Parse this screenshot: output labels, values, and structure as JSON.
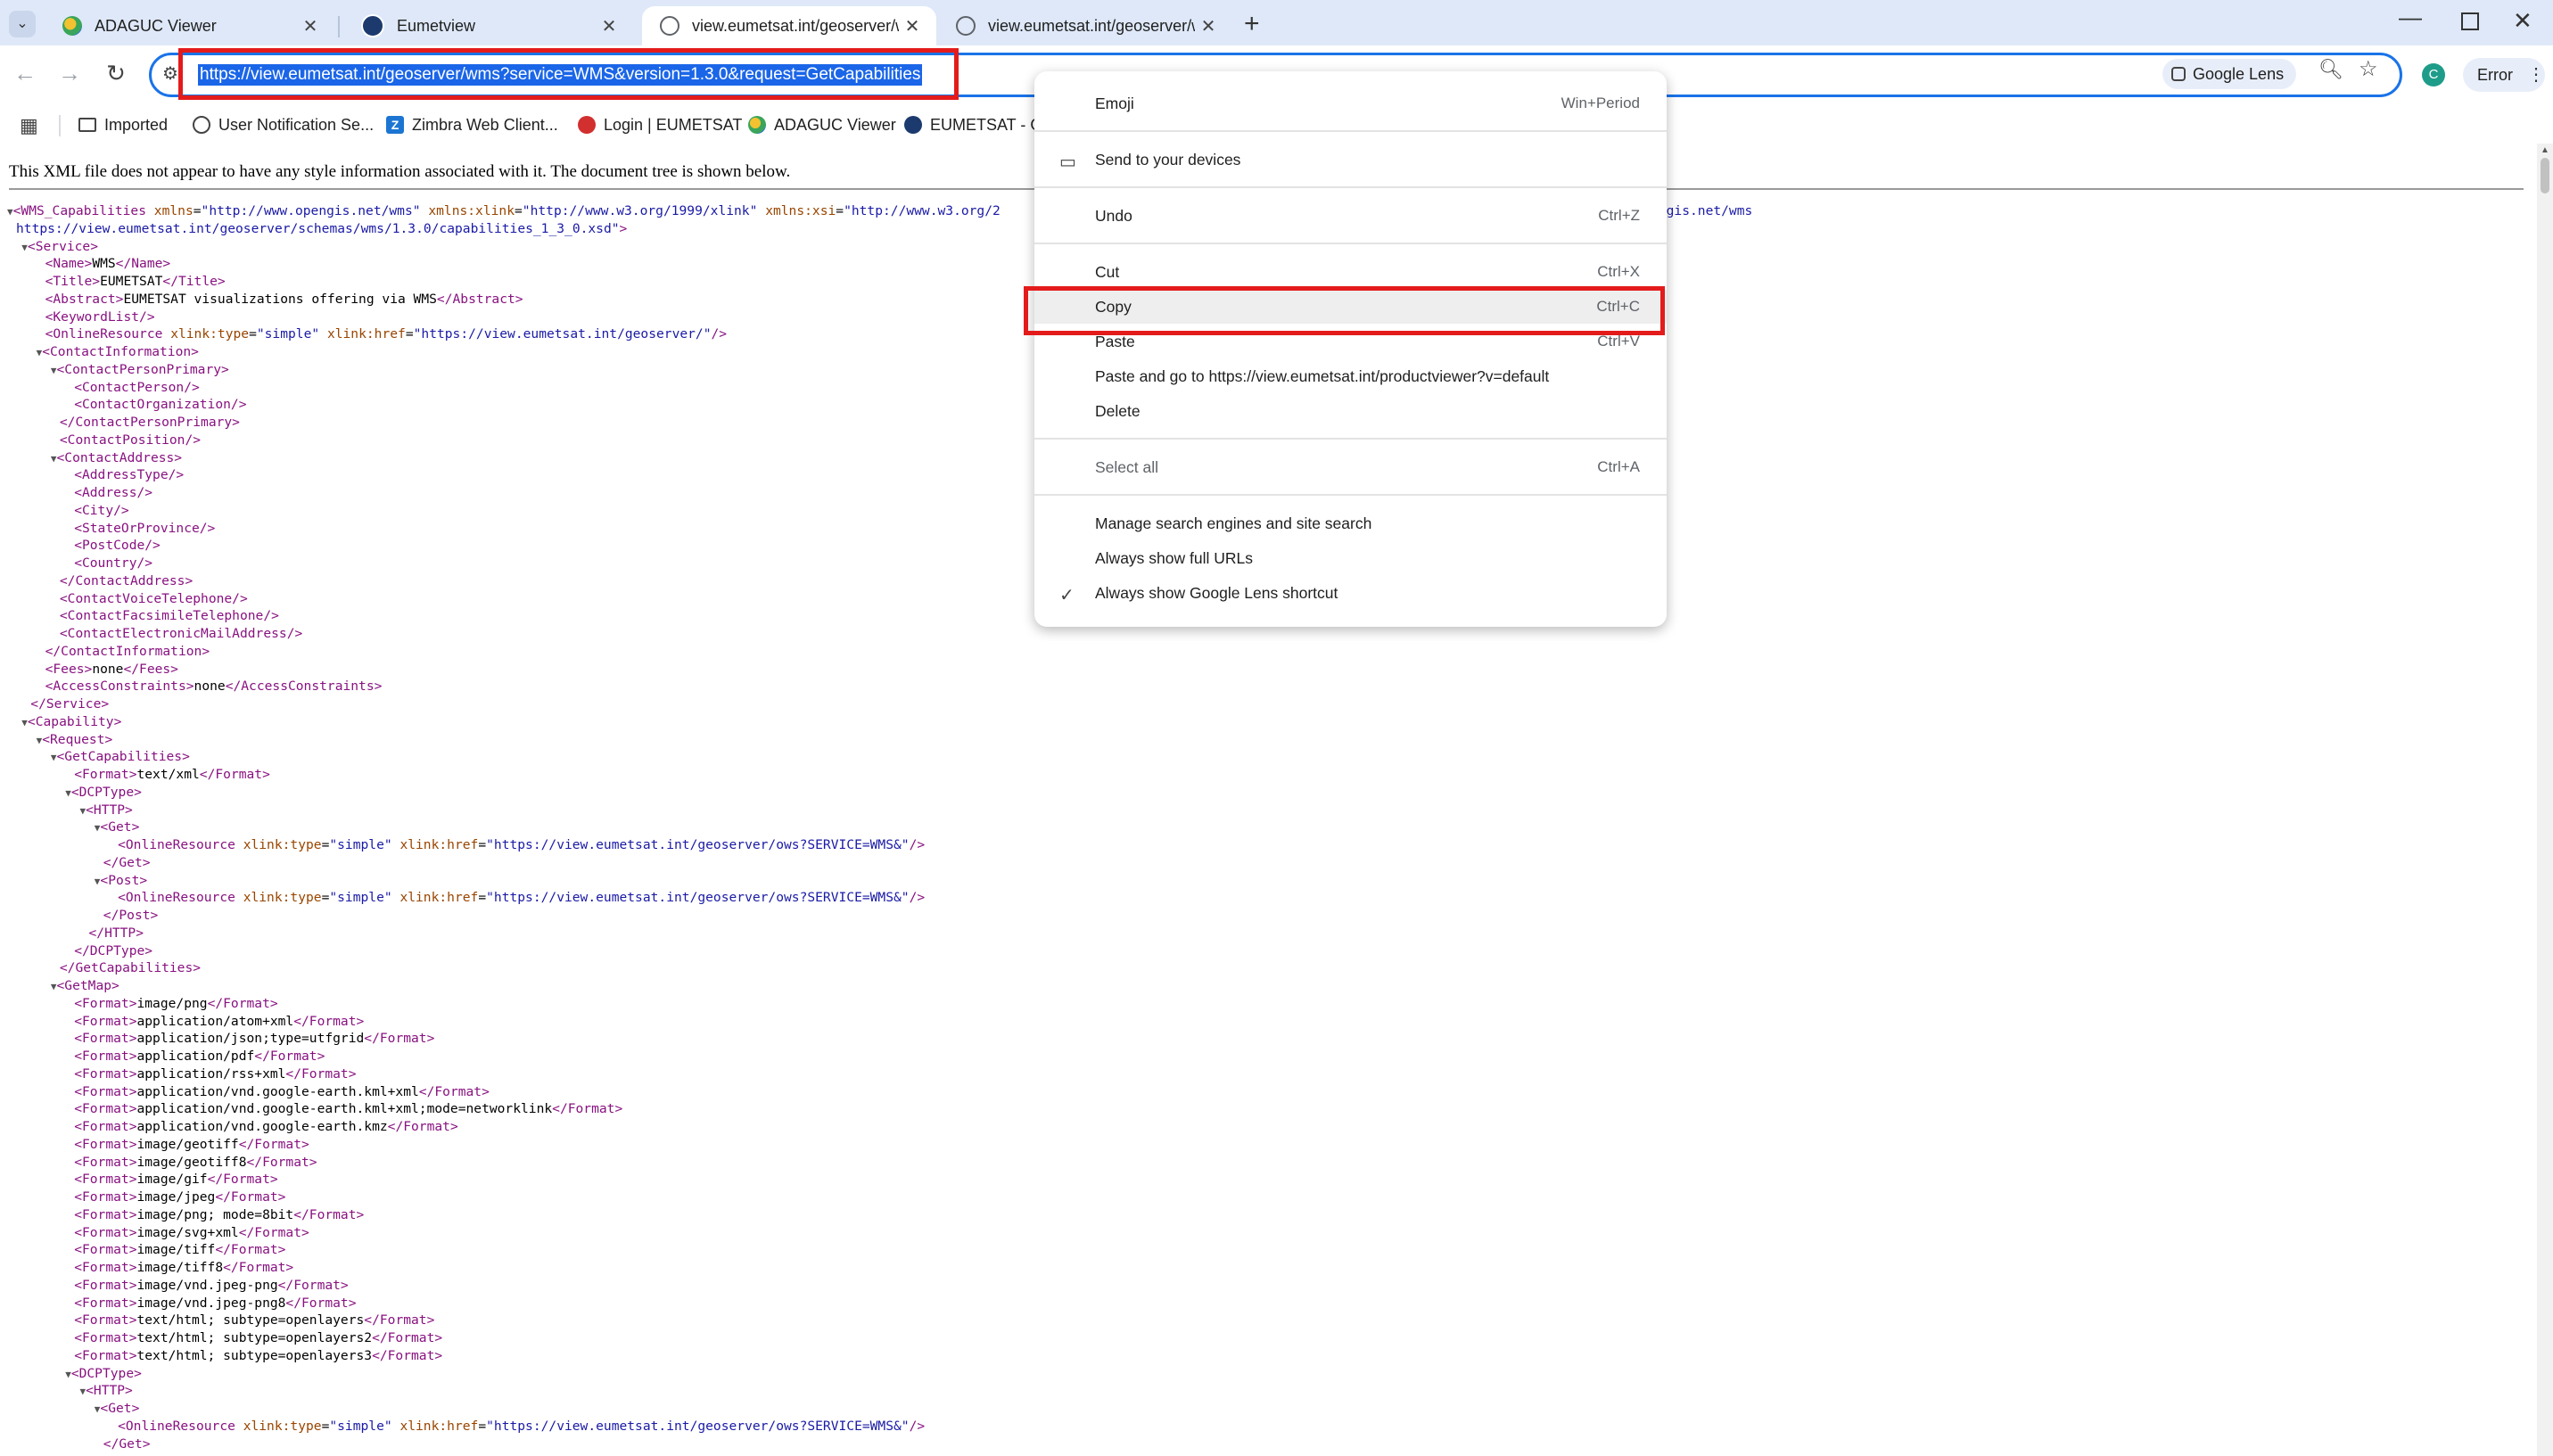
{
  "tabs": [
    {
      "title": "ADAGUC Viewer",
      "active": false
    },
    {
      "title": "Eumetview",
      "active": false
    },
    {
      "title": "view.eumetsat.int/geoserver/wm",
      "active": true
    },
    {
      "title": "view.eumetsat.int/geoserver/wm",
      "active": false
    }
  ],
  "toolbar": {
    "url": "https://view.eumetsat.int/geoserver/wms?service=WMS&version=1.3.0&request=GetCapabilities",
    "lens_label": "Google Lens",
    "profile_initial": "C",
    "error_label": "Error"
  },
  "bookmarks": [
    {
      "label": "Imported"
    },
    {
      "label": "User Notification Se..."
    },
    {
      "label": "Zimbra Web Client..."
    },
    {
      "label": "Login | EUMETSAT"
    },
    {
      "label": "ADAGUC Viewer"
    },
    {
      "label": "EUMETSAT - OS"
    }
  ],
  "page": {
    "notice": "This XML file does not appear to have any style information associated with it. The document tree is shown below."
  },
  "xml_lines": [
    {
      "i": 0,
      "t": "▼",
      "h": "<span class='tg'>&lt;WMS_Capabilities</span> <span class='an'>xmlns</span>=<span class='av'>\"http://www.opengis.net/wms\"</span> <span class='an'>xmlns:xlink</span>=<span class='av'>\"http://www.w3.org/1999/xlink\"</span> <span class='an'>xmlns:xsi</span>=<span class='av'>\"http://www.w3.org/2</span>                                                                  <span class='an'>on</span>=<span class='av'>\"http://www.opengis.net/wms</span>"
    },
    {
      "i": 0,
      "t": "",
      "h": "<span class='av'>https://view.eumetsat.int/geoserver/schemas/wms/1.3.0/capabilities_1_3_0.xsd\"</span><span class='tg'>&gt;</span>"
    },
    {
      "i": 1,
      "t": "▼",
      "h": "<span class='tg'>&lt;Service&gt;</span>"
    },
    {
      "i": 2,
      "t": "",
      "h": "<span class='tg'>&lt;Name&gt;</span>WMS<span class='tg'>&lt;/Name&gt;</span>"
    },
    {
      "i": 2,
      "t": "",
      "h": "<span class='tg'>&lt;Title&gt;</span>EUMETSAT<span class='tg'>&lt;/Title&gt;</span>"
    },
    {
      "i": 2,
      "t": "",
      "h": "<span class='tg'>&lt;Abstract&gt;</span>EUMETSAT visualizations offering via WMS<span class='tg'>&lt;/Abstract&gt;</span>"
    },
    {
      "i": 2,
      "t": "",
      "h": "<span class='tg'>&lt;KeywordList/&gt;</span>"
    },
    {
      "i": 2,
      "t": "",
      "h": "<span class='tg'>&lt;OnlineResource</span> <span class='an'>xlink:type</span>=<span class='av'>\"simple\"</span> <span class='an'>xlink:href</span>=<span class='av'>\"https://view.eumetsat.int/geoserver/\"</span><span class='tg'>/&gt;</span>"
    },
    {
      "i": 2,
      "t": "▼",
      "h": "<span class='tg'>&lt;ContactInformation&gt;</span>"
    },
    {
      "i": 3,
      "t": "▼",
      "h": "<span class='tg'>&lt;ContactPersonPrimary&gt;</span>"
    },
    {
      "i": 4,
      "t": "",
      "h": "<span class='tg'>&lt;ContactPerson/&gt;</span>"
    },
    {
      "i": 4,
      "t": "",
      "h": "<span class='tg'>&lt;ContactOrganization/&gt;</span>"
    },
    {
      "i": 3,
      "t": "",
      "h": "<span class='tg'>&lt;/ContactPersonPrimary&gt;</span>"
    },
    {
      "i": 3,
      "t": "",
      "h": "<span class='tg'>&lt;ContactPosition/&gt;</span>"
    },
    {
      "i": 3,
      "t": "▼",
      "h": "<span class='tg'>&lt;ContactAddress&gt;</span>"
    },
    {
      "i": 4,
      "t": "",
      "h": "<span class='tg'>&lt;AddressType/&gt;</span>"
    },
    {
      "i": 4,
      "t": "",
      "h": "<span class='tg'>&lt;Address/&gt;</span>"
    },
    {
      "i": 4,
      "t": "",
      "h": "<span class='tg'>&lt;City/&gt;</span>"
    },
    {
      "i": 4,
      "t": "",
      "h": "<span class='tg'>&lt;StateOrProvince/&gt;</span>"
    },
    {
      "i": 4,
      "t": "",
      "h": "<span class='tg'>&lt;PostCode/&gt;</span>"
    },
    {
      "i": 4,
      "t": "",
      "h": "<span class='tg'>&lt;Country/&gt;</span>"
    },
    {
      "i": 3,
      "t": "",
      "h": "<span class='tg'>&lt;/ContactAddress&gt;</span>"
    },
    {
      "i": 3,
      "t": "",
      "h": "<span class='tg'>&lt;ContactVoiceTelephone/&gt;</span>"
    },
    {
      "i": 3,
      "t": "",
      "h": "<span class='tg'>&lt;ContactFacsimileTelephone/&gt;</span>"
    },
    {
      "i": 3,
      "t": "",
      "h": "<span class='tg'>&lt;ContactElectronicMailAddress/&gt;</span>"
    },
    {
      "i": 2,
      "t": "",
      "h": "<span class='tg'>&lt;/ContactInformation&gt;</span>"
    },
    {
      "i": 2,
      "t": "",
      "h": "<span class='tg'>&lt;Fees&gt;</span>none<span class='tg'>&lt;/Fees&gt;</span>"
    },
    {
      "i": 2,
      "t": "",
      "h": "<span class='tg'>&lt;AccessConstraints&gt;</span>none<span class='tg'>&lt;/AccessConstraints&gt;</span>"
    },
    {
      "i": 1,
      "t": "",
      "h": "<span class='tg'>&lt;/Service&gt;</span>"
    },
    {
      "i": 1,
      "t": "▼",
      "h": "<span class='tg'>&lt;Capability&gt;</span>"
    },
    {
      "i": 2,
      "t": "▼",
      "h": "<span class='tg'>&lt;Request&gt;</span>"
    },
    {
      "i": 3,
      "t": "▼",
      "h": "<span class='tg'>&lt;GetCapabilities&gt;</span>"
    },
    {
      "i": 4,
      "t": "",
      "h": "<span class='tg'>&lt;Format&gt;</span>text/xml<span class='tg'>&lt;/Format&gt;</span>"
    },
    {
      "i": 4,
      "t": "▼",
      "h": "<span class='tg'>&lt;DCPType&gt;</span>"
    },
    {
      "i": 5,
      "t": "▼",
      "h": "<span class='tg'>&lt;HTTP&gt;</span>"
    },
    {
      "i": 6,
      "t": "▼",
      "h": "<span class='tg'>&lt;Get&gt;</span>"
    },
    {
      "i": 7,
      "t": "",
      "h": "<span class='tg'>&lt;OnlineResource</span> <span class='an'>xlink:type</span>=<span class='av'>\"simple\"</span> <span class='an'>xlink:href</span>=<span class='av'>\"https://view.eumetsat.int/geoserver/ows?SERVICE=WMS&amp;\"</span><span class='tg'>/&gt;</span>"
    },
    {
      "i": 6,
      "t": "",
      "h": "<span class='tg'>&lt;/Get&gt;</span>"
    },
    {
      "i": 6,
      "t": "▼",
      "h": "<span class='tg'>&lt;Post&gt;</span>"
    },
    {
      "i": 7,
      "t": "",
      "h": "<span class='tg'>&lt;OnlineResource</span> <span class='an'>xlink:type</span>=<span class='av'>\"simple\"</span> <span class='an'>xlink:href</span>=<span class='av'>\"https://view.eumetsat.int/geoserver/ows?SERVICE=WMS&amp;\"</span><span class='tg'>/&gt;</span>"
    },
    {
      "i": 6,
      "t": "",
      "h": "<span class='tg'>&lt;/Post&gt;</span>"
    },
    {
      "i": 5,
      "t": "",
      "h": "<span class='tg'>&lt;/HTTP&gt;</span>"
    },
    {
      "i": 4,
      "t": "",
      "h": "<span class='tg'>&lt;/DCPType&gt;</span>"
    },
    {
      "i": 3,
      "t": "",
      "h": "<span class='tg'>&lt;/GetCapabilities&gt;</span>"
    },
    {
      "i": 3,
      "t": "▼",
      "h": "<span class='tg'>&lt;GetMap&gt;</span>"
    },
    {
      "i": 4,
      "t": "",
      "h": "<span class='tg'>&lt;Format&gt;</span>image/png<span class='tg'>&lt;/Format&gt;</span>"
    },
    {
      "i": 4,
      "t": "",
      "h": "<span class='tg'>&lt;Format&gt;</span>application/atom+xml<span class='tg'>&lt;/Format&gt;</span>"
    },
    {
      "i": 4,
      "t": "",
      "h": "<span class='tg'>&lt;Format&gt;</span>application/json;type=utfgrid<span class='tg'>&lt;/Format&gt;</span>"
    },
    {
      "i": 4,
      "t": "",
      "h": "<span class='tg'>&lt;Format&gt;</span>application/pdf<span class='tg'>&lt;/Format&gt;</span>"
    },
    {
      "i": 4,
      "t": "",
      "h": "<span class='tg'>&lt;Format&gt;</span>application/rss+xml<span class='tg'>&lt;/Format&gt;</span>"
    },
    {
      "i": 4,
      "t": "",
      "h": "<span class='tg'>&lt;Format&gt;</span>application/vnd.google-earth.kml+xml<span class='tg'>&lt;/Format&gt;</span>"
    },
    {
      "i": 4,
      "t": "",
      "h": "<span class='tg'>&lt;Format&gt;</span>application/vnd.google-earth.kml+xml;mode=networklink<span class='tg'>&lt;/Format&gt;</span>"
    },
    {
      "i": 4,
      "t": "",
      "h": "<span class='tg'>&lt;Format&gt;</span>application/vnd.google-earth.kmz<span class='tg'>&lt;/Format&gt;</span>"
    },
    {
      "i": 4,
      "t": "",
      "h": "<span class='tg'>&lt;Format&gt;</span>image/geotiff<span class='tg'>&lt;/Format&gt;</span>"
    },
    {
      "i": 4,
      "t": "",
      "h": "<span class='tg'>&lt;Format&gt;</span>image/geotiff8<span class='tg'>&lt;/Format&gt;</span>"
    },
    {
      "i": 4,
      "t": "",
      "h": "<span class='tg'>&lt;Format&gt;</span>image/gif<span class='tg'>&lt;/Format&gt;</span>"
    },
    {
      "i": 4,
      "t": "",
      "h": "<span class='tg'>&lt;Format&gt;</span>image/jpeg<span class='tg'>&lt;/Format&gt;</span>"
    },
    {
      "i": 4,
      "t": "",
      "h": "<span class='tg'>&lt;Format&gt;</span>image/png; mode=8bit<span class='tg'>&lt;/Format&gt;</span>"
    },
    {
      "i": 4,
      "t": "",
      "h": "<span class='tg'>&lt;Format&gt;</span>image/svg+xml<span class='tg'>&lt;/Format&gt;</span>"
    },
    {
      "i": 4,
      "t": "",
      "h": "<span class='tg'>&lt;Format&gt;</span>image/tiff<span class='tg'>&lt;/Format&gt;</span>"
    },
    {
      "i": 4,
      "t": "",
      "h": "<span class='tg'>&lt;Format&gt;</span>image/tiff8<span class='tg'>&lt;/Format&gt;</span>"
    },
    {
      "i": 4,
      "t": "",
      "h": "<span class='tg'>&lt;Format&gt;</span>image/vnd.jpeg-png<span class='tg'>&lt;/Format&gt;</span>"
    },
    {
      "i": 4,
      "t": "",
      "h": "<span class='tg'>&lt;Format&gt;</span>image/vnd.jpeg-png8<span class='tg'>&lt;/Format&gt;</span>"
    },
    {
      "i": 4,
      "t": "",
      "h": "<span class='tg'>&lt;Format&gt;</span>text/html; subtype=openlayers<span class='tg'>&lt;/Format&gt;</span>"
    },
    {
      "i": 4,
      "t": "",
      "h": "<span class='tg'>&lt;Format&gt;</span>text/html; subtype=openlayers2<span class='tg'>&lt;/Format&gt;</span>"
    },
    {
      "i": 4,
      "t": "",
      "h": "<span class='tg'>&lt;Format&gt;</span>text/html; subtype=openlayers3<span class='tg'>&lt;/Format&gt;</span>"
    },
    {
      "i": 4,
      "t": "▼",
      "h": "<span class='tg'>&lt;DCPType&gt;</span>"
    },
    {
      "i": 5,
      "t": "▼",
      "h": "<span class='tg'>&lt;HTTP&gt;</span>"
    },
    {
      "i": 6,
      "t": "▼",
      "h": "<span class='tg'>&lt;Get&gt;</span>"
    },
    {
      "i": 7,
      "t": "",
      "h": "<span class='tg'>&lt;OnlineResource</span> <span class='an'>xlink:type</span>=<span class='av'>\"simple\"</span> <span class='an'>xlink:href</span>=<span class='av'>\"https://view.eumetsat.int/geoserver/ows?SERVICE=WMS&amp;\"</span><span class='tg'>/&gt;</span>"
    },
    {
      "i": 6,
      "t": "",
      "h": "<span class='tg'>&lt;/Get&gt;</span>"
    }
  ],
  "context_menu": {
    "items": [
      {
        "label": "Emoji",
        "shortcut": "Win+Period"
      },
      {
        "label": "Send to your devices",
        "shortcut": ""
      },
      {
        "label": "Undo",
        "shortcut": "Ctrl+Z"
      },
      {
        "label": "Cut",
        "shortcut": "Ctrl+X"
      },
      {
        "label": "Copy",
        "shortcut": "Ctrl+C"
      },
      {
        "label": "Paste",
        "shortcut": "Ctrl+V"
      },
      {
        "label": "Paste and go to https://view.eumetsat.int/productviewer?v=default",
        "shortcut": ""
      },
      {
        "label": "Delete",
        "shortcut": ""
      },
      {
        "label": "Select all",
        "shortcut": "Ctrl+A"
      },
      {
        "label": "Manage search engines and site search",
        "shortcut": ""
      },
      {
        "label": "Always show full URLs",
        "shortcut": ""
      },
      {
        "label": "Always show Google Lens shortcut",
        "shortcut": "",
        "checked": true
      }
    ]
  },
  "colors": {
    "tabbar": "#dee8f8",
    "url_highlight": "#1b66e8",
    "annotation_red": "#e41b1b",
    "xml_tag": "#881280",
    "xml_attr": "#994500",
    "xml_value": "#1a1aa6"
  }
}
